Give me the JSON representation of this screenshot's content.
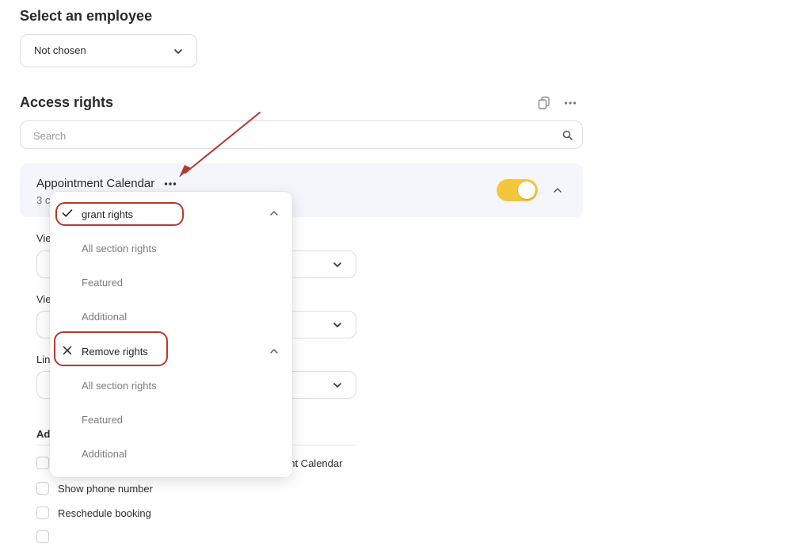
{
  "employee": {
    "heading": "Select an employee",
    "select_value": "Not chosen"
  },
  "access": {
    "heading": "Access rights",
    "search_placeholder": "Search",
    "section": {
      "title": "Appointment Calendar",
      "subtitle_visible": "3 c",
      "toggle_on": true
    },
    "field_labels_partial": [
      "Vie",
      "Vie",
      "Lin"
    ],
    "additional_heading_partial": "Ad",
    "checkbox_items": [
      {
        "label": "ent Calendar"
      },
      {
        "label": "Show phone number"
      },
      {
        "label": "Reschedule booking"
      }
    ]
  },
  "menu": {
    "groups": [
      {
        "header": "grant rights",
        "icon": "check-icon",
        "items": [
          "All section rights",
          "Featured",
          "Additional"
        ]
      },
      {
        "header": "Remove rights",
        "icon": "x-icon",
        "items": [
          "All section rights",
          "Featured",
          "Additional"
        ]
      }
    ]
  },
  "colors": {
    "toggle": "#f5c63c",
    "annotation": "#b5382e",
    "section_bg": "#f4f6fb"
  }
}
